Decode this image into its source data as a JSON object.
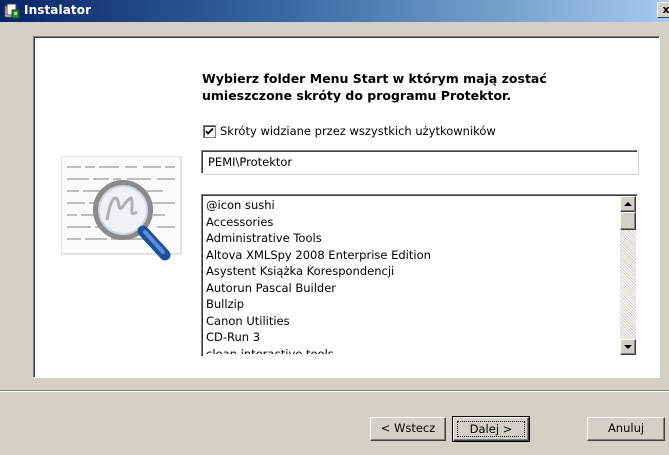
{
  "window": {
    "title": "Instalator",
    "icon": "installer-app-icon",
    "close_label": "x"
  },
  "heading": {
    "line1": "Wybierz folder Menu Start w którym mają zostać",
    "line2": "umieszczone skróty do programu Protektor."
  },
  "all_users_checkbox": {
    "checked": true,
    "label": "Skróty widziane przez wszystkich użytkowników"
  },
  "folder_path": {
    "value": "PEMI\\Protektor"
  },
  "folder_list": {
    "items": [
      "@icon sushi",
      "Accessories",
      "Administrative Tools",
      "Altova XMLSpy 2008 Enterprise Edition",
      "Asystent Książka Korespondencji",
      "Autorun Pascal Builder",
      "Bullzip",
      "Canon Utilities",
      "CD-Run 3",
      "clean interactive tools"
    ]
  },
  "buttons": {
    "back": "< Wstecz",
    "next": "Dalej >",
    "cancel": "Anuluj"
  },
  "colors": {
    "dialog_bg": "#d4d0c8",
    "title_bar_start": "#0a246a",
    "title_bar_end": "#a6caf0"
  }
}
